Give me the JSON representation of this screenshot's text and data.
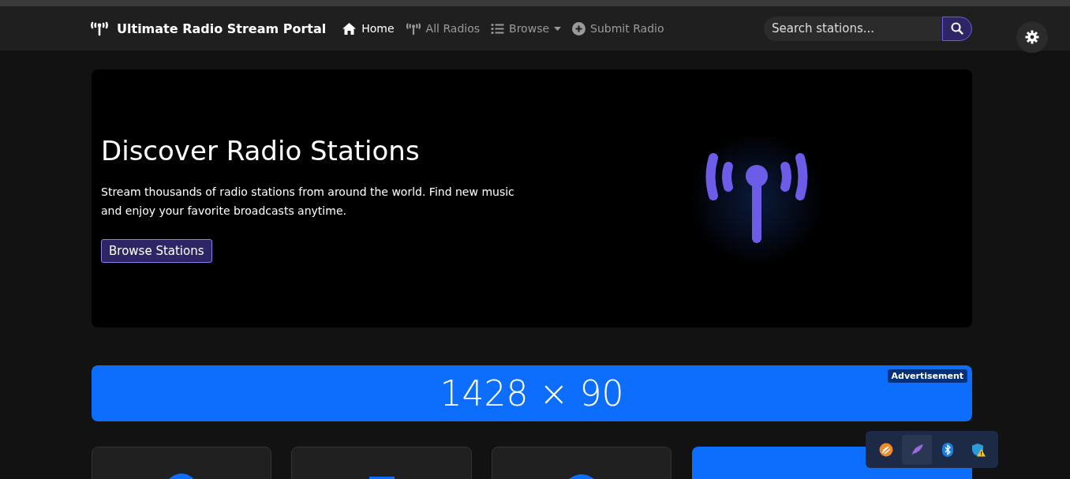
{
  "navbar": {
    "brand": "Ultimate Radio Stream Portal",
    "links": [
      {
        "label": "Home",
        "selected": true,
        "dropdown": false
      },
      {
        "label": "All Radios",
        "selected": false,
        "dropdown": false
      },
      {
        "label": "Browse",
        "selected": false,
        "dropdown": true
      },
      {
        "label": "Submit Radio",
        "selected": false,
        "dropdown": false
      }
    ],
    "search": {
      "placeholder": "Search stations..."
    }
  },
  "hero": {
    "title": "Discover Radio Stations",
    "text": "Stream thousands of radio stations from around the world. Find new music and enjoy your favorite broadcasts anytime.",
    "button": "Browse Stations"
  },
  "ad": {
    "size": "1428 × 90",
    "badge": "Advertisement"
  }
}
